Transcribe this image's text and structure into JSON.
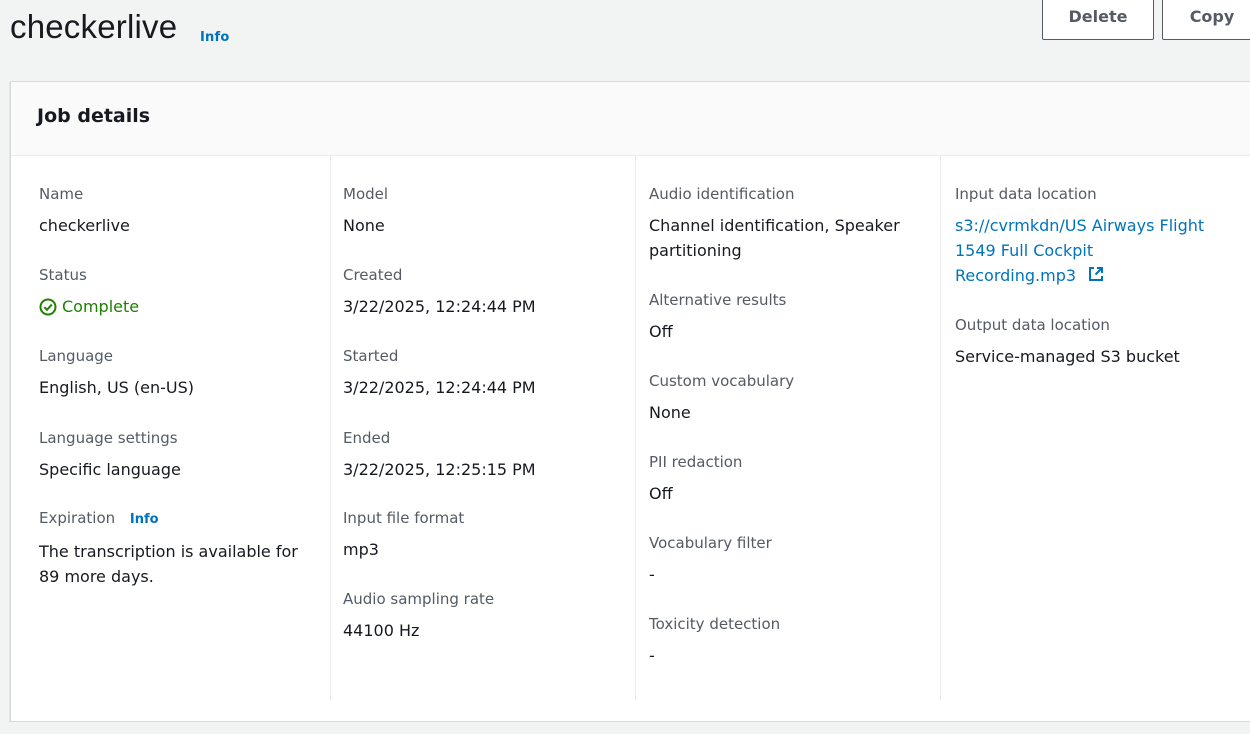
{
  "header": {
    "title": "checkerlive",
    "info": "Info",
    "delete_label": "Delete",
    "copy_label": "Copy"
  },
  "panel": {
    "title": "Job details"
  },
  "col1": {
    "name_label": "Name",
    "name_value": "checkerlive",
    "status_label": "Status",
    "status_value": "Complete",
    "language_label": "Language",
    "language_value": "English, US (en-US)",
    "language_settings_label": "Language settings",
    "language_settings_value": "Specific language",
    "expiration_label": "Expiration",
    "expiration_info": "Info",
    "expiration_line1": "The transcription is available for",
    "expiration_line2": "89 more days."
  },
  "col2": {
    "model_label": "Model",
    "model_value": "None",
    "created_label": "Created",
    "created_value": "3/22/2025, 12:24:44 PM",
    "started_label": "Started",
    "started_value": "3/22/2025, 12:24:44 PM",
    "ended_label": "Ended",
    "ended_value": "3/22/2025, 12:25:15 PM",
    "format_label": "Input file format",
    "format_value": "mp3",
    "sampling_label": "Audio sampling rate",
    "sampling_value": "44100 Hz"
  },
  "col3": {
    "audio_id_label": "Audio identification",
    "audio_id_line1": "Channel identification, Speaker",
    "audio_id_line2": "partitioning",
    "alt_label": "Alternative results",
    "alt_value": "Off",
    "vocab_label": "Custom vocabulary",
    "vocab_value": "None",
    "pii_label": "PII redaction",
    "pii_value": "Off",
    "vfilter_label": "Vocabulary filter",
    "vfilter_value": "-",
    "toxicity_label": "Toxicity detection",
    "toxicity_value": "-"
  },
  "col4": {
    "input_label": "Input data location",
    "input_line1": "s3://cvrmkdn/US Airways Flight",
    "input_line2": "1549 Full Cockpit",
    "input_line3": "Recording.mp3",
    "output_label": "Output data location",
    "output_value": "Service-managed S3 bucket"
  },
  "colors": {
    "accent": "#0073bb",
    "success": "#1d8102",
    "text": "#16191f",
    "muted": "#545b64"
  }
}
